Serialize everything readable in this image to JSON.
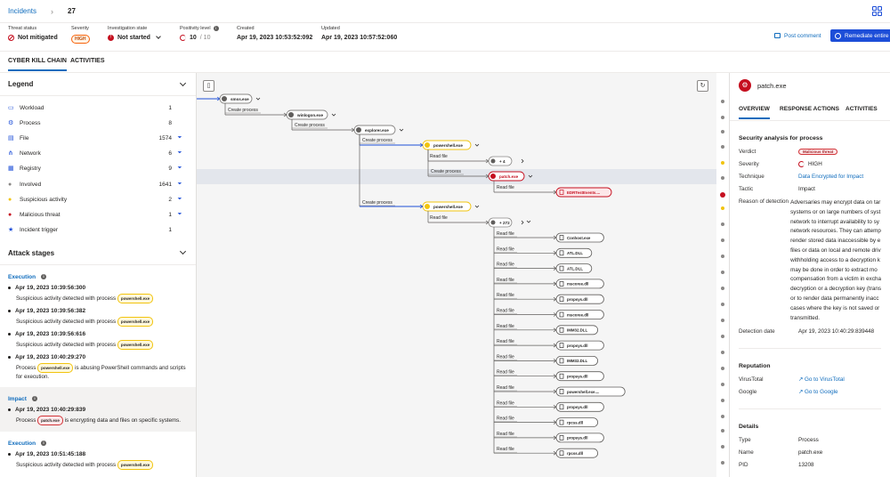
{
  "breadcrumb": {
    "root": "Incidents",
    "current": "27"
  },
  "meta": {
    "threat_status": {
      "label": "Threat status",
      "value": "Not mitigated"
    },
    "severity": {
      "label": "Severity",
      "value": "HIGH"
    },
    "investigation": {
      "label": "Investigation state",
      "value": "Not started"
    },
    "positivity": {
      "label": "Positivity level",
      "value": "10",
      "max": "/ 10"
    },
    "created": {
      "label": "Created",
      "value": "Apr 19, 2023 10:53:52:092"
    },
    "updated": {
      "label": "Updated",
      "value": "Apr 19, 2023 10:57:52:060"
    }
  },
  "actions": {
    "post_comment": "Post comment",
    "remediate": "Remediate entire"
  },
  "tabs": [
    "CYBER KILL CHAIN",
    "ACTIVITIES"
  ],
  "legend": {
    "title": "Legend",
    "items": [
      {
        "label": "Workload",
        "count": "1",
        "icon": "workload-icon",
        "color": "#1d4ed8",
        "filter": false
      },
      {
        "label": "Process",
        "count": "8",
        "icon": "process-icon",
        "color": "#1d4ed8",
        "filter": false
      },
      {
        "label": "File",
        "count": "1574",
        "icon": "file-icon",
        "color": "#1d4ed8",
        "filter": true
      },
      {
        "label": "Network",
        "count": "6",
        "icon": "network-icon",
        "color": "#1d4ed8",
        "filter": true
      },
      {
        "label": "Registry",
        "count": "9",
        "icon": "registry-icon",
        "color": "#1d4ed8",
        "filter": true
      },
      {
        "label": "Involved",
        "count": "1641",
        "icon": "dot-icon",
        "color": "#8a8886",
        "filter": true
      },
      {
        "label": "Suspicious activity",
        "count": "2",
        "icon": "dot-icon",
        "color": "#f1c40f",
        "filter": true
      },
      {
        "label": "Malicious threat",
        "count": "1",
        "icon": "dot-icon",
        "color": "#c50f1f",
        "filter": true
      },
      {
        "label": "Incident trigger",
        "count": "1",
        "icon": "star-icon",
        "color": "#1d4ed8",
        "filter": false
      }
    ]
  },
  "attack_stages": {
    "title": "Attack stages",
    "groups": [
      {
        "name": "Execution",
        "highlight": false,
        "events": [
          {
            "time": "Apr 19, 2023 10:39:56:300",
            "pre": "Suspicious activity detected with process",
            "pill": "powershell.exe",
            "post": "",
            "red": false
          },
          {
            "time": "Apr 19, 2023 10:39:56:382",
            "pre": "Suspicious activity detected with process",
            "pill": "powershell.exe",
            "post": "",
            "red": false
          },
          {
            "time": "Apr 19, 2023 10:39:56:616",
            "pre": "Suspicious activity detected with process",
            "pill": "powershell.exe",
            "post": "",
            "red": false
          },
          {
            "time": "Apr 19, 2023 10:40:29:270",
            "pre": "Process",
            "pill": "powershell.exe",
            "post": "is abusing PowerShell commands and scripts for execution.",
            "red": false
          }
        ]
      },
      {
        "name": "Impact",
        "highlight": true,
        "events": [
          {
            "time": "Apr 19, 2023 10:40:29:839",
            "pre": "Process",
            "pill": "patch.exe",
            "post": "is encrypting data and files on specific systems.",
            "red": true
          }
        ]
      },
      {
        "name": "Execution",
        "highlight": false,
        "events": [
          {
            "time": "Apr 19, 2023 10:51:45:188",
            "pre": "Suspicious activity detected with process",
            "pill": "powershell.exe",
            "post": "",
            "red": false
          }
        ]
      }
    ]
  },
  "graph": {
    "nodes": [
      {
        "label": "smss.exe",
        "kind": "process"
      },
      {
        "label": "winlogon.exe",
        "kind": "process"
      },
      {
        "label": "explorer.exe",
        "kind": "process"
      },
      {
        "label": "powershell.exe",
        "kind": "process-suspicious"
      },
      {
        "label": "+ 4",
        "kind": "group"
      },
      {
        "label": "patch.exe",
        "kind": "process-malicious"
      },
      {
        "label": "EDRTestEvents....",
        "kind": "file-malicious"
      },
      {
        "label": "powershell.exe",
        "kind": "process-suspicious"
      },
      {
        "label": "+ 272",
        "kind": "group"
      }
    ],
    "edges": {
      "create": "Create process",
      "read": "Read file"
    },
    "files": [
      "Conhost.exe",
      "ATL.DLL",
      "ATL.DLL",
      "mscoree.dll",
      "propsys.dll",
      "mscoree.dll",
      "IMM32.DLL",
      "propsys.dll",
      "IMM32.DLL",
      "propsys.dll",
      "powershell.exe....",
      "propsys.dll",
      "rpcss.dll",
      "propsys.dll",
      "rpcss.dll"
    ]
  },
  "detail": {
    "title": "patch.exe",
    "tabs": [
      "OVERVIEW",
      "RESPONSE ACTIONS",
      "ACTIVITIES"
    ],
    "security_title": "Security analysis for process",
    "verdict": {
      "k": "Verdict",
      "v": "Malicious threat"
    },
    "severity": {
      "k": "Severity",
      "v": "HIGH"
    },
    "technique": {
      "k": "Technique",
      "v": "Data Encrypted for Impact"
    },
    "tactic": {
      "k": "Tactic",
      "v": "Impact"
    },
    "reason_k": "Reason of detection",
    "reason_lines": [
      "Adversaries may encrypt data on tar",
      "systems or on large numbers of syst",
      "network to interrupt availability to sy",
      "network resources. They can attemp",
      "render stored data inaccessible by e",
      "files or data on local and remote driv",
      "withholding access to a decryption k",
      "may be done in order to extract mo",
      "compensation from a victim in excha",
      "decryption or a decryption key (trans",
      "or to render data permanently inacc",
      "cases where the key is not saved or",
      "transmitted."
    ],
    "detection_date": {
      "k": "Detection date",
      "v": "Apr 19, 2023 10:40:29:839448"
    },
    "reputation_title": "Reputation",
    "virustotal": {
      "k": "VirusTotal",
      "v": "Go to VirusTotal"
    },
    "google": {
      "k": "Google",
      "v": "Go to Google"
    },
    "details_title": "Details",
    "type": {
      "k": "Type",
      "v": "Process"
    },
    "name": {
      "k": "Name",
      "v": "patch.exe"
    },
    "pid": {
      "k": "PID",
      "v": "13208"
    }
  }
}
